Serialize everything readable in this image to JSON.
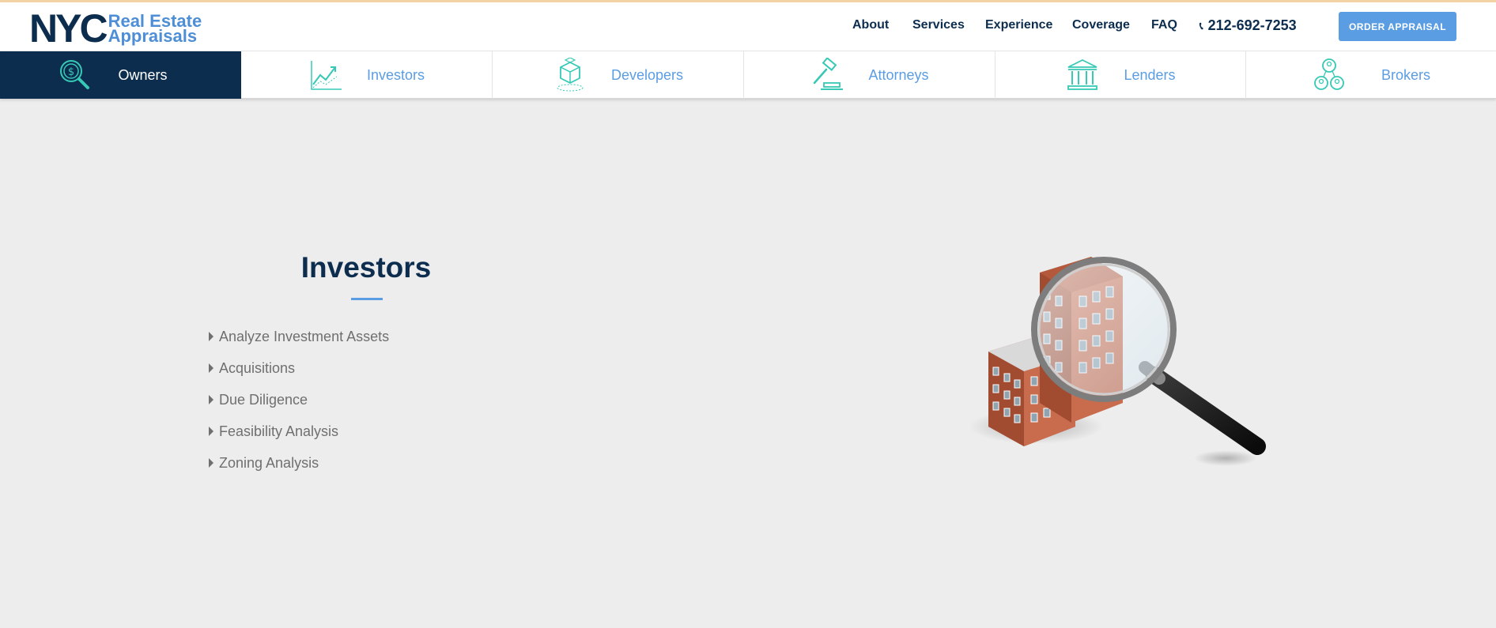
{
  "brand": {
    "logo_main": "NYC",
    "logo_line1": "Real Estate",
    "logo_line2": "Appraisals"
  },
  "nav": {
    "items": [
      "About",
      "Services",
      "Experience",
      "Coverage",
      "FAQ"
    ],
    "phone": "212-692-7253",
    "cta": "ORDER APPRAISAL"
  },
  "tabs": [
    {
      "label": "Owners",
      "icon": "magnifier-dollar-icon",
      "active": true
    },
    {
      "label": "Investors",
      "icon": "growth-chart-icon",
      "active": false
    },
    {
      "label": "Developers",
      "icon": "cube-icon",
      "active": false
    },
    {
      "label": "Attorneys",
      "icon": "gavel-icon",
      "active": false
    },
    {
      "label": "Lenders",
      "icon": "bank-icon",
      "active": false
    },
    {
      "label": "Brokers",
      "icon": "people-network-icon",
      "active": false
    }
  ],
  "section": {
    "title": "Investors",
    "items": [
      "Analyze Investment Assets",
      "Acquisitions",
      "Due Diligence",
      "Feasibility Analysis",
      "Zoning Analysis"
    ]
  },
  "colors": {
    "navy": "#0d2d4f",
    "accent": "#5b9de3",
    "teal_icon": "#36c9b5",
    "background": "#ededed"
  }
}
